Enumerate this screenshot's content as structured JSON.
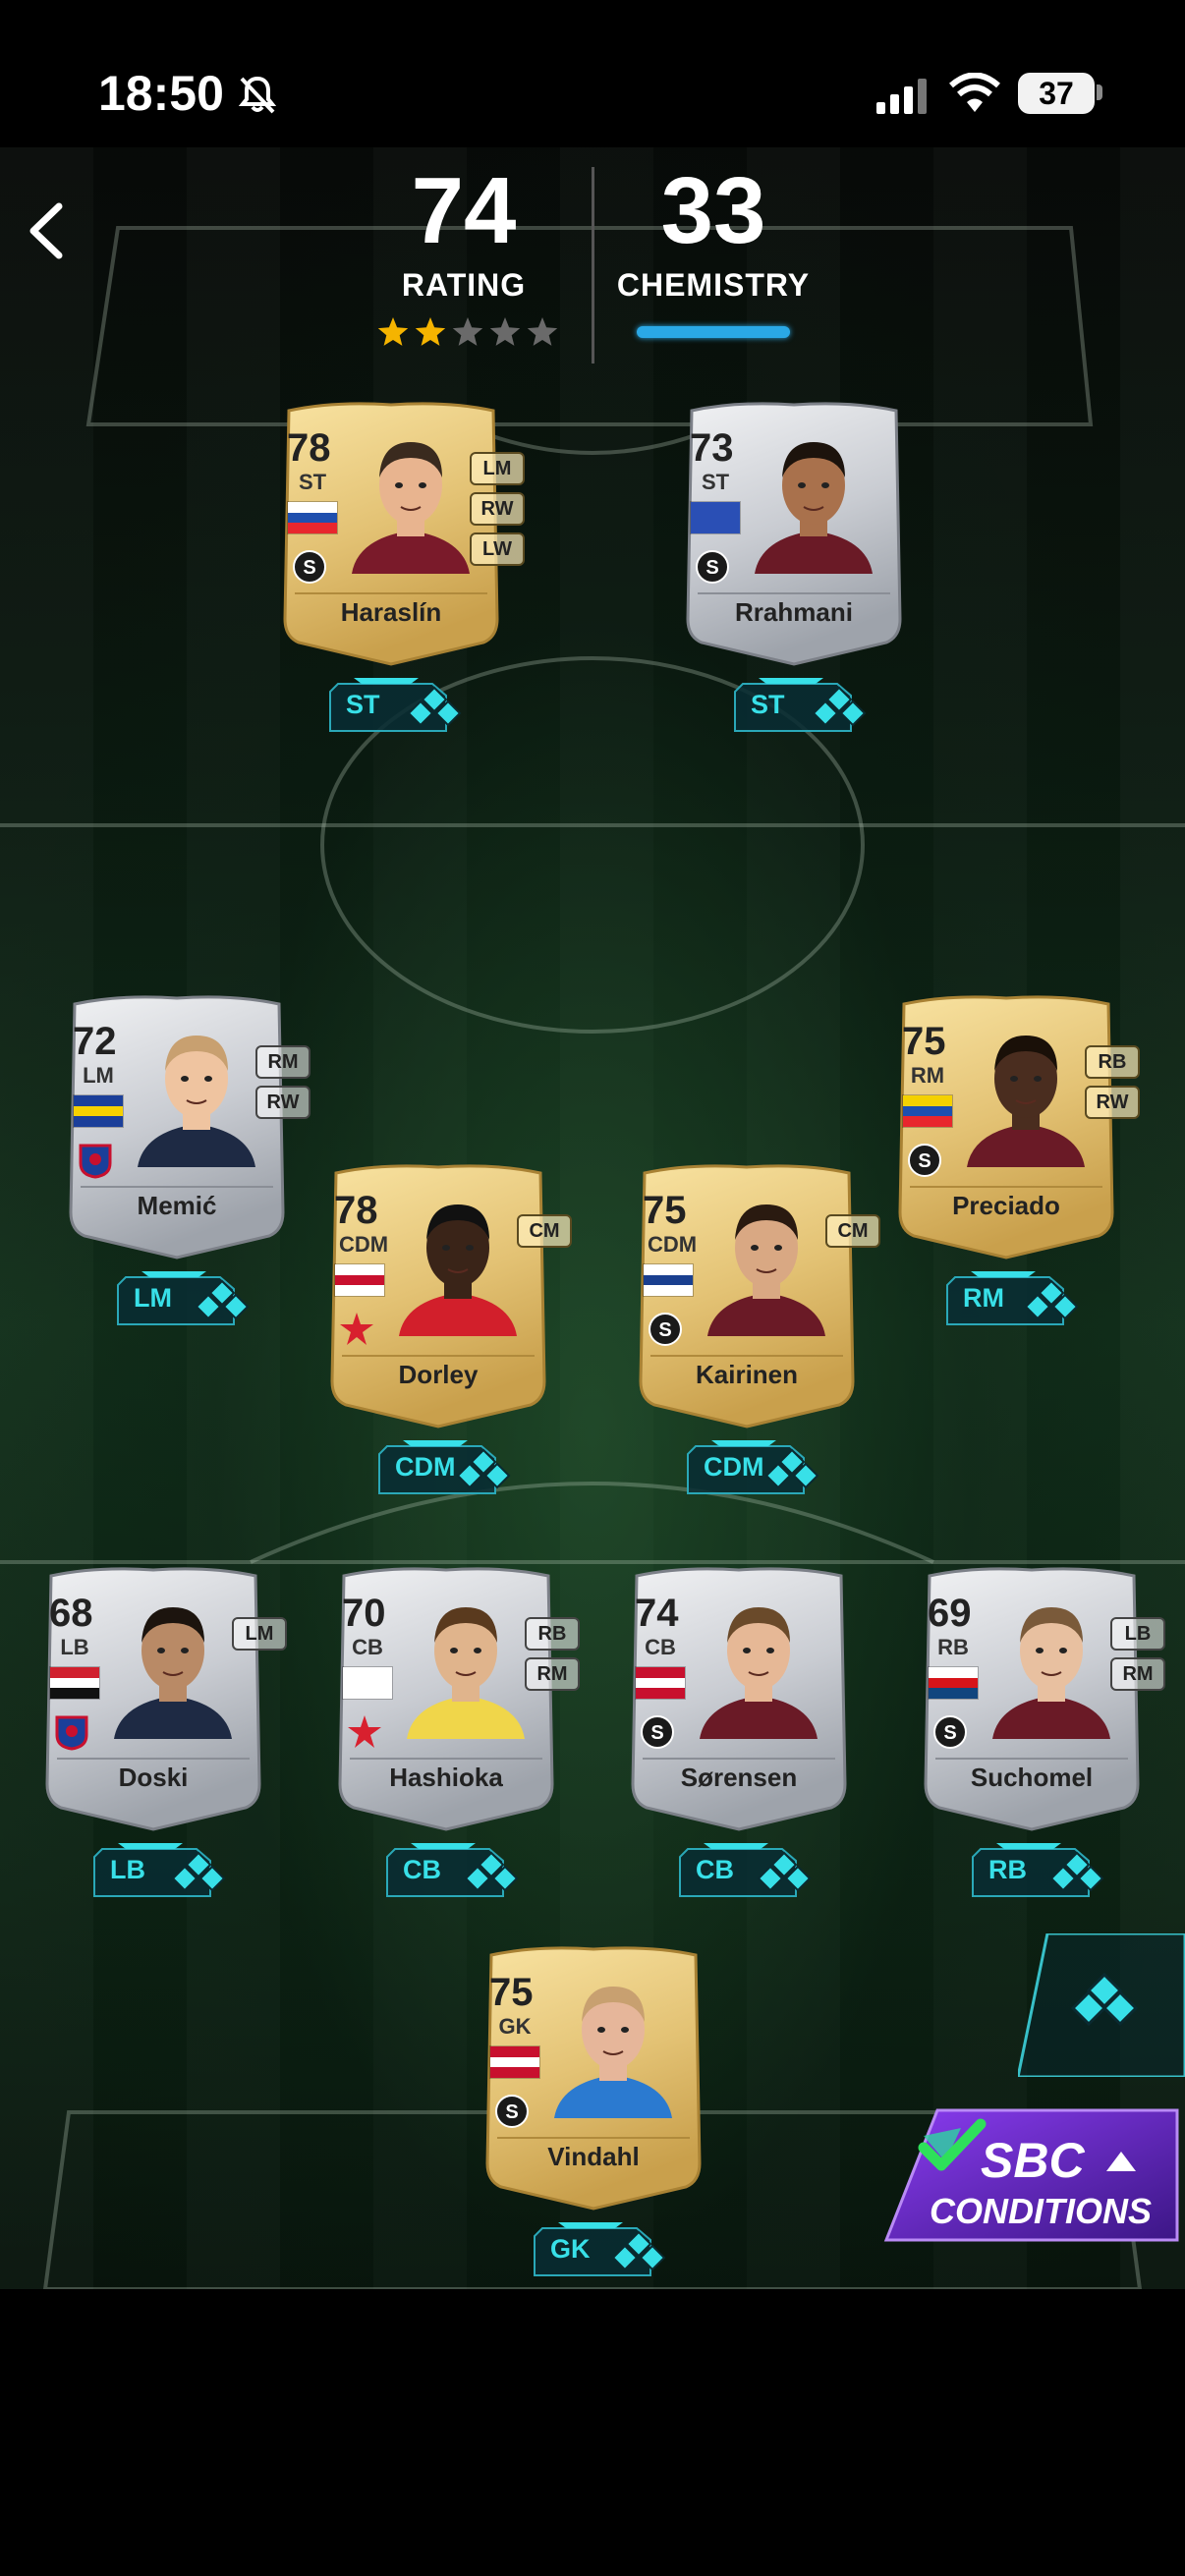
{
  "status_bar": {
    "time": "18:50",
    "battery": "37"
  },
  "header": {
    "rating_value": "74",
    "rating_label": "RATING",
    "chemistry_value": "33",
    "chemistry_label": "CHEMISTRY",
    "stars_filled": 2,
    "stars_total": 5
  },
  "players": [
    {
      "name": "Haraslín",
      "rating": "78",
      "position": "ST",
      "alt_positions": [
        "LM",
        "RW",
        "LW"
      ],
      "slot": "ST",
      "tier": "gold"
    },
    {
      "name": "Rrahmani",
      "rating": "73",
      "position": "ST",
      "alt_positions": [],
      "slot": "ST",
      "tier": "silver"
    },
    {
      "name": "Memić",
      "rating": "72",
      "position": "LM",
      "alt_positions": [
        "RM",
        "RW"
      ],
      "slot": "LM",
      "tier": "silver"
    },
    {
      "name": "Preciado",
      "rating": "75",
      "position": "RM",
      "alt_positions": [
        "RB",
        "RW"
      ],
      "slot": "RM",
      "tier": "gold"
    },
    {
      "name": "Dorley",
      "rating": "78",
      "position": "CDM",
      "alt_positions": [
        "CM"
      ],
      "slot": "CDM",
      "tier": "gold"
    },
    {
      "name": "Kairinen",
      "rating": "75",
      "position": "CDM",
      "alt_positions": [
        "CM"
      ],
      "slot": "CDM",
      "tier": "gold"
    },
    {
      "name": "Doski",
      "rating": "68",
      "position": "LB",
      "alt_positions": [
        "LM"
      ],
      "slot": "LB",
      "tier": "silver"
    },
    {
      "name": "Hashioka",
      "rating": "70",
      "position": "CB",
      "alt_positions": [
        "RB",
        "RM"
      ],
      "slot": "CB",
      "tier": "silver"
    },
    {
      "name": "Sørensen",
      "rating": "74",
      "position": "CB",
      "alt_positions": [],
      "slot": "CB",
      "tier": "silver"
    },
    {
      "name": "Suchomel",
      "rating": "69",
      "position": "RB",
      "alt_positions": [
        "LB",
        "RM"
      ],
      "slot": "RB",
      "tier": "silver"
    },
    {
      "name": "Vindahl",
      "rating": "75",
      "position": "GK",
      "alt_positions": [],
      "slot": "GK",
      "tier": "gold"
    }
  ],
  "sbc_button": {
    "title": "SBC",
    "subtitle": "CONDITIONS"
  },
  "colors": {
    "accent_cyan": "#38e0e8",
    "chem_bar": "#2aa8e6",
    "star_gold": "#f5b400",
    "sbc_purple": "#6a2bd6"
  }
}
